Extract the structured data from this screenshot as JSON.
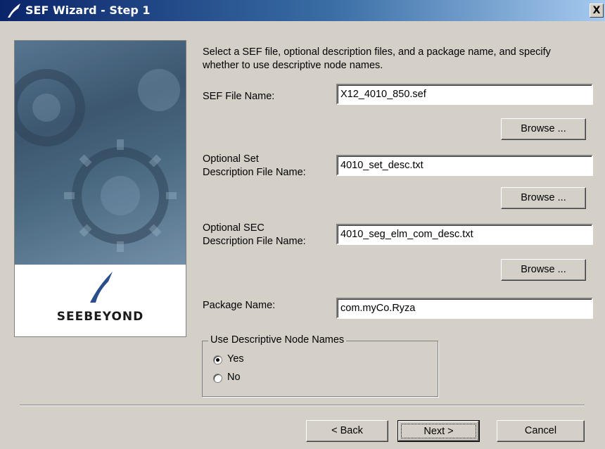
{
  "window": {
    "title": "SEF Wizard - Step 1",
    "close_label": "X"
  },
  "banner": {
    "brand": "SEEBEYOND"
  },
  "intro": "Select a SEF file, optional description files, and a package name, and specify whether to use descriptive node names.",
  "fields": {
    "sef": {
      "label": "SEF File Name:",
      "value": "X12_4010_850.sef",
      "browse": "Browse ..."
    },
    "set_desc": {
      "label_line1": "Optional Set",
      "label_line2": "Description File Name:",
      "value": "4010_set_desc.txt",
      "browse": "Browse ..."
    },
    "sec_desc": {
      "label_line1": "Optional SEC",
      "label_line2": "Description File Name:",
      "value": "4010_seg_elm_com_desc.txt",
      "browse": "Browse ..."
    },
    "package": {
      "label": "Package Name:",
      "value": "com.myCo.Ryza"
    }
  },
  "node_names": {
    "legend": "Use Descriptive Node Names",
    "options": [
      "Yes",
      "No"
    ],
    "selected": "Yes"
  },
  "buttons": {
    "back": "< Back",
    "next": "Next >",
    "cancel": "Cancel"
  },
  "colors": {
    "dialog_bg": "#d4d0c8",
    "title_start": "#0a246a",
    "title_end": "#a6caf0"
  }
}
